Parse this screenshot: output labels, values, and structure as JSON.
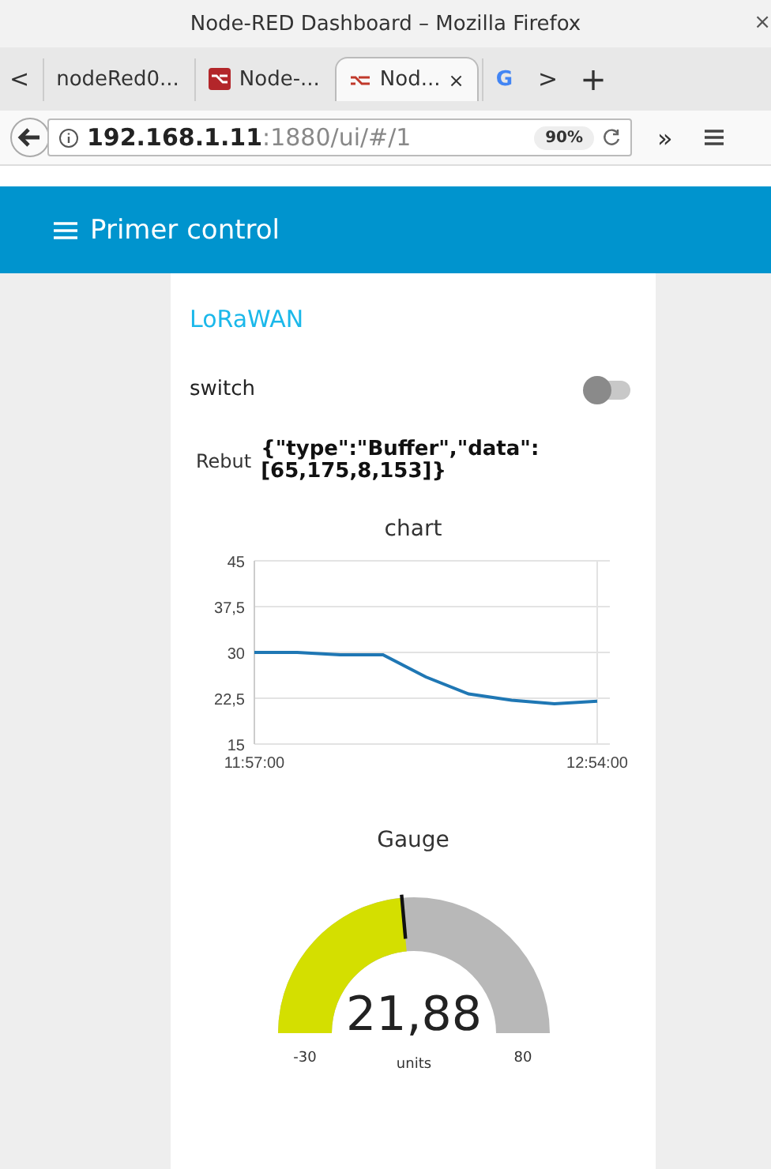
{
  "window": {
    "title": "Node-RED Dashboard – Mozilla Firefox",
    "close": "×"
  },
  "tabs_bar": {
    "scroll_left": "<",
    "scroll_right": ">",
    "new_tab": "+"
  },
  "tabs": [
    {
      "label": "nodeRed0...",
      "kind": "plain",
      "selected": false
    },
    {
      "label": "Node-...",
      "kind": "favicon",
      "selected": false
    },
    {
      "label": "Nod...",
      "kind": "flow",
      "selected": true,
      "close": "×"
    },
    {
      "label": "G",
      "kind": "logo",
      "selected": false
    }
  ],
  "address_bar": {
    "host": "192.168.1.11",
    "path": ":1880/ui/#/1",
    "zoom": "90%",
    "overflow": "»"
  },
  "header": {
    "title": "Primer control"
  },
  "group": {
    "title": "LoRaWAN"
  },
  "switch": {
    "label": "switch",
    "on": false
  },
  "text_widget": {
    "label": "Rebut",
    "value": "{\"type\":\"Buffer\",\"data\":[65,175,8,153]}"
  },
  "chart": {
    "title": "chart",
    "chart_data": {
      "type": "line",
      "categories": [
        "11:57:00",
        null,
        null,
        null,
        null,
        null,
        null,
        null,
        "12:54:00"
      ],
      "series": [
        {
          "color": "#1f77b4",
          "values": [
            30,
            30,
            29.6,
            29.6,
            26,
            23.2,
            22.2,
            21.6,
            22
          ]
        }
      ],
      "ylim": [
        15,
        45
      ],
      "grid": true,
      "yticks": [
        {
          "value": 45,
          "label": "45"
        },
        {
          "value": 37.5,
          "label": "37,5"
        },
        {
          "value": 30,
          "label": "30"
        },
        {
          "value": 22.5,
          "label": "22,5"
        },
        {
          "value": 15,
          "label": "15"
        }
      ]
    }
  },
  "gauge": {
    "title": "Gauge",
    "value": "21,88",
    "units": "units",
    "min": "-30",
    "max": "80"
  }
}
